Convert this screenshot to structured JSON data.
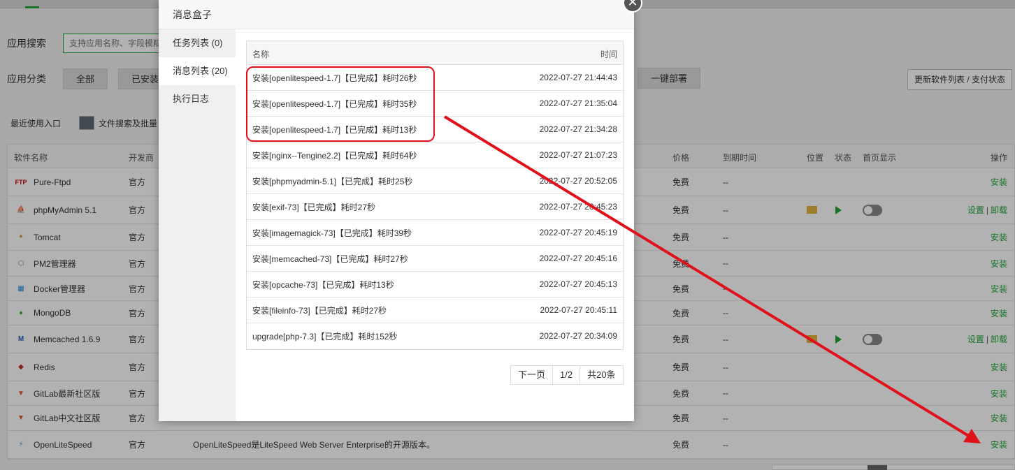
{
  "page": {
    "search_label": "应用搜索",
    "search_placeholder": "支持应用名称、字段模糊",
    "category_label": "应用分类",
    "categories": [
      "全部",
      "已安装"
    ],
    "deploy_button": "一键部署",
    "update_button": "更新软件列表 / 支付状态",
    "recent_label": "最近使用入口",
    "recent_item": "文件搜索及批量"
  },
  "table": {
    "headers": {
      "name": "软件名称",
      "dev": "开发商",
      "price": "价格",
      "expire": "到期时间",
      "location": "位置",
      "status": "状态",
      "home": "首页显示",
      "ops": "操作"
    },
    "rows": [
      {
        "icon": "ftp-icon",
        "name": "Pure-Ftpd",
        "dev": "官方",
        "desc": "",
        "price": "免费",
        "expire": "--",
        "ops": [
          "安装"
        ],
        "installed": false
      },
      {
        "icon": "phpmyadmin-icon",
        "name": "phpMyAdmin 5.1",
        "dev": "官方",
        "desc": "",
        "price": "免费",
        "expire": "--",
        "ops": [
          "设置",
          "卸载"
        ],
        "installed": true
      },
      {
        "icon": "tomcat-icon",
        "name": "Tomcat",
        "dev": "官方",
        "desc": "",
        "price": "免费",
        "expire": "--",
        "ops": [
          "安装"
        ],
        "installed": false
      },
      {
        "icon": "nodejs-icon",
        "name": "PM2管理器",
        "dev": "官方",
        "desc": "",
        "price": "免费",
        "expire": "--",
        "ops": [
          "安装"
        ],
        "installed": false
      },
      {
        "icon": "docker-icon",
        "name": "Docker管理器",
        "dev": "官方",
        "desc": "",
        "price": "免费",
        "expire": "--",
        "ops": [
          "安装"
        ],
        "installed": false
      },
      {
        "icon": "mongodb-icon",
        "name": "MongoDB",
        "dev": "官方",
        "desc": "",
        "price": "免费",
        "expire": "--",
        "ops": [
          "安装"
        ],
        "installed": false
      },
      {
        "icon": "memcached-icon",
        "name": "Memcached 1.6.9",
        "dev": "官方",
        "desc": "",
        "price": "免费",
        "expire": "--",
        "ops": [
          "设置",
          "卸载"
        ],
        "installed": true
      },
      {
        "icon": "redis-icon",
        "name": "Redis",
        "dev": "官方",
        "desc": "",
        "price": "免费",
        "expire": "--",
        "ops": [
          "安装"
        ],
        "installed": false
      },
      {
        "icon": "gitlab-icon",
        "name": "GitLab最新社区版",
        "dev": "官方",
        "desc": "",
        "price": "免费",
        "expire": "--",
        "ops": [
          "安装"
        ],
        "installed": false
      },
      {
        "icon": "gitlab-icon",
        "name": "GitLab中文社区版",
        "dev": "官方",
        "desc": "",
        "price": "免费",
        "expire": "--",
        "ops": [
          "安装"
        ],
        "installed": false
      },
      {
        "icon": "openlitespeed-icon",
        "name": "OpenLiteSpeed",
        "dev": "官方",
        "desc": "OpenLiteSpeed是LiteSpeed Web Server Enterprise的开源版本。",
        "price": "免费",
        "expire": "--",
        "ops": [
          "安装"
        ],
        "installed": false
      }
    ]
  },
  "modal": {
    "title": "消息盒子",
    "close_glyph": "✕",
    "tabs": [
      "任务列表 (0)",
      "消息列表 (20)",
      "执行日志"
    ],
    "active_tab": 1,
    "columns": {
      "name": "名称",
      "time": "时间"
    },
    "messages": [
      {
        "name": "安装[openlitespeed-1.7]【已完成】耗时26秒",
        "time": "2022-07-27 21:44:43"
      },
      {
        "name": "安装[openlitespeed-1.7]【已完成】耗时35秒",
        "time": "2022-07-27 21:35:04"
      },
      {
        "name": "安装[openlitespeed-1.7]【已完成】耗时13秒",
        "time": "2022-07-27 21:34:28"
      },
      {
        "name": "安装[nginx--Tengine2.2]【已完成】耗时64秒",
        "time": "2022-07-27 21:07:23"
      },
      {
        "name": "安装[phpmyadmin-5.1]【已完成】耗时25秒",
        "time": "2022-07-27 20:52:05"
      },
      {
        "name": "安装[exif-73]【已完成】耗时27秒",
        "time": "2022-07-27 20:45:23"
      },
      {
        "name": "安装[imagemagick-73]【已完成】耗时39秒",
        "time": "2022-07-27 20:45:19"
      },
      {
        "name": "安装[memcached-73]【已完成】耗时27秒",
        "time": "2022-07-27 20:45:16"
      },
      {
        "name": "安装[opcache-73]【已完成】耗时13秒",
        "time": "2022-07-27 20:45:13"
      },
      {
        "name": "安装[fileinfo-73]【已完成】耗时27秒",
        "time": "2022-07-27 20:45:11"
      },
      {
        "name": "upgrade[php-7.3]【已完成】耗时152秒",
        "time": "2022-07-27 20:34:09"
      }
    ],
    "pager": {
      "next": "下一页",
      "page": "1/2",
      "total": "共20条"
    }
  },
  "annotations": {
    "highlight_color": "#e0111b",
    "accent_green": "#20a53a"
  }
}
